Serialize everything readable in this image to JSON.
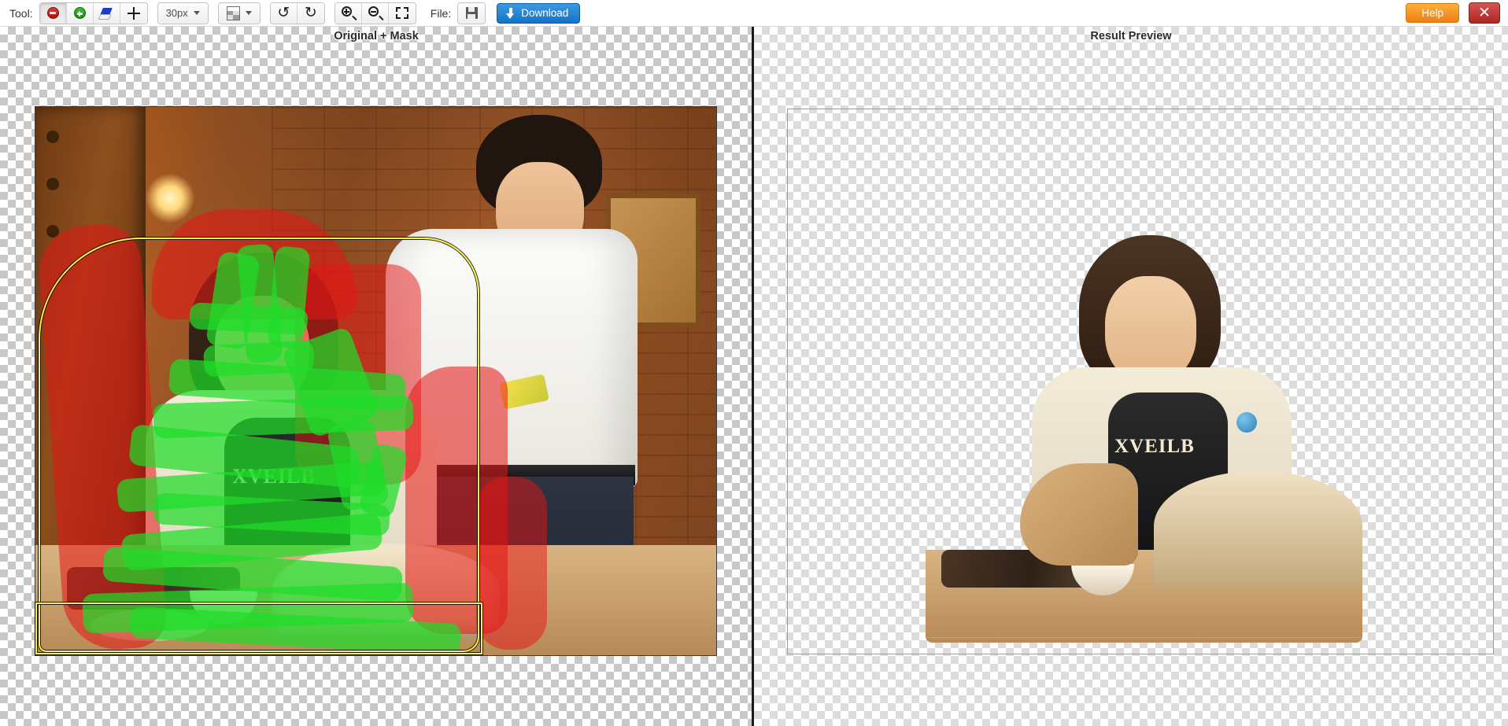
{
  "toolbar": {
    "tool_label": "Tool:",
    "tools": [
      {
        "name": "mark-background-tool",
        "icon": "minus-circle-icon",
        "active": true
      },
      {
        "name": "mark-foreground-tool",
        "icon": "plus-circle-icon",
        "active": false
      },
      {
        "name": "eraser-tool",
        "icon": "eraser-icon",
        "active": false
      },
      {
        "name": "move-tool",
        "icon": "move-icon",
        "active": false
      }
    ],
    "brush_size": "30px",
    "background_pattern_label": "",
    "undo_label": "↺",
    "redo_label": "↻",
    "file_label": "File:",
    "download_label": "Download",
    "help_label": "Help",
    "close_label": "✕"
  },
  "panels": {
    "left_title": "Original + Mask",
    "right_title": "Result Preview"
  },
  "image": {
    "tee_text_left": "XVEILB",
    "tee_text_right": "XVEILB"
  }
}
